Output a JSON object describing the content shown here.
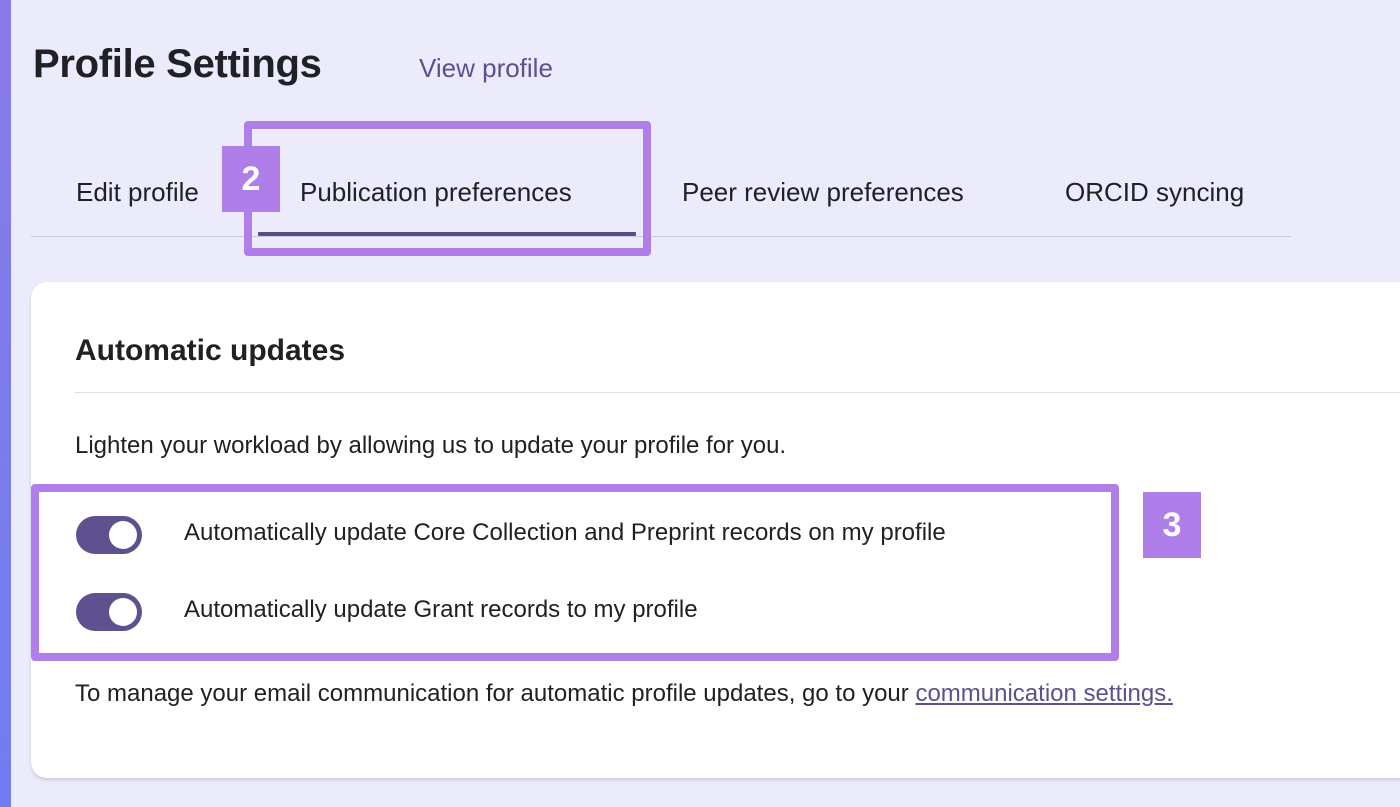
{
  "header": {
    "title": "Profile Settings",
    "view_profile_link": "View profile"
  },
  "tabs": [
    {
      "label": "Edit profile",
      "active": false
    },
    {
      "label": "Publication preferences",
      "active": true
    },
    {
      "label": "Peer review preferences",
      "active": false
    },
    {
      "label": "ORCID syncing",
      "active": false
    }
  ],
  "card": {
    "heading": "Automatic updates",
    "description": "Lighten your workload by allowing us to update your profile for you.",
    "toggles": [
      {
        "label": "Automatically update Core Collection and Preprint records on my profile",
        "on": true
      },
      {
        "label": "Automatically update Grant records to my profile",
        "on": true
      }
    ],
    "footer_text": "To manage your email communication for automatic profile updates, go to your ",
    "footer_link": "communication settings."
  },
  "annotations": {
    "badge_2": "2",
    "badge_3": "3"
  },
  "colors": {
    "accent": "#5f5090",
    "link": "#5e4f8f",
    "highlight": "#b07ee8",
    "page_background": "#ebebfc",
    "card_background": "#ffffff"
  }
}
